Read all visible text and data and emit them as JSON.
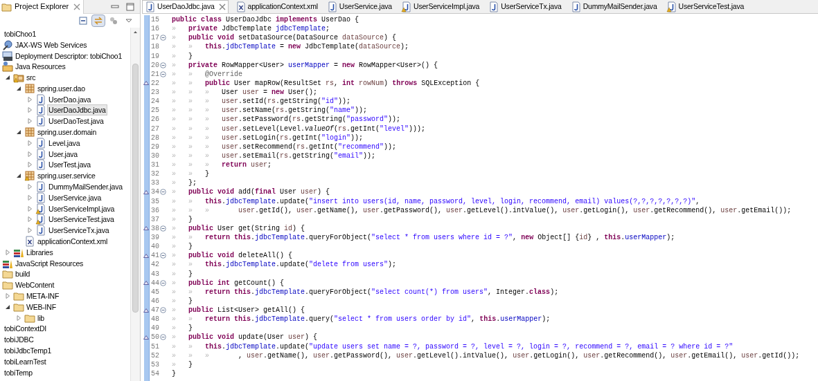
{
  "explorer": {
    "title": "Project Explorer",
    "toolbar": [
      {
        "kind": "collapse-all",
        "pressed": false
      },
      {
        "kind": "link-editor",
        "pressed": true
      },
      {
        "kind": "filters",
        "pressed": false
      },
      {
        "kind": "view-menu",
        "pressed": false
      }
    ],
    "tree": [
      {
        "label": "tobiChoo1",
        "selected": false,
        "children": [
          {
            "label": "JAX-WS Web Services",
            "kind": "webservices",
            "selected": false
          },
          {
            "label": "Deployment Descriptor: tobiChoo1",
            "kind": "descriptor",
            "selected": false
          },
          {
            "label": "Java Resources",
            "kind": "javares",
            "selected": false,
            "children": [
              {
                "label": "src",
                "kind": "src-warn",
                "expanded": true,
                "selected": false,
                "children": [
                  {
                    "label": "spring.user.dao",
                    "kind": "package",
                    "expanded": true,
                    "selected": false,
                    "children": [
                      {
                        "label": "UserDao.java",
                        "kind": "java",
                        "expanded": false,
                        "selected": false
                      },
                      {
                        "label": "UserDaoJdbc.java",
                        "kind": "java",
                        "expanded": false,
                        "selected": true
                      },
                      {
                        "label": "UserDaoTest.java",
                        "kind": "java",
                        "expanded": false,
                        "selected": false
                      }
                    ]
                  },
                  {
                    "label": "spring.user.domain",
                    "kind": "package",
                    "expanded": true,
                    "selected": false,
                    "children": [
                      {
                        "label": "Level.java",
                        "kind": "java",
                        "expanded": false,
                        "selected": false
                      },
                      {
                        "label": "User.java",
                        "kind": "java",
                        "expanded": false,
                        "selected": false
                      },
                      {
                        "label": "UserTest.java",
                        "kind": "java",
                        "expanded": false,
                        "selected": false
                      }
                    ]
                  },
                  {
                    "label": "spring.user.service",
                    "kind": "package-warn",
                    "expanded": true,
                    "selected": false,
                    "children": [
                      {
                        "label": "DummyMailSender.java",
                        "kind": "java",
                        "expanded": false,
                        "selected": false
                      },
                      {
                        "label": "UserService.java",
                        "kind": "java",
                        "expanded": false,
                        "selected": false
                      },
                      {
                        "label": "UserServiceImpl.java",
                        "kind": "java-warn",
                        "expanded": false,
                        "selected": false
                      },
                      {
                        "label": "UserServiceTest.java",
                        "kind": "java-warn",
                        "expanded": false,
                        "selected": false
                      },
                      {
                        "label": "UserServiceTx.java",
                        "kind": "java",
                        "expanded": false,
                        "selected": false
                      }
                    ]
                  },
                  {
                    "label": "applicationContext.xml",
                    "kind": "xml",
                    "selected": false
                  }
                ]
              },
              {
                "label": "Libraries",
                "kind": "library",
                "expanded": false,
                "selected": false
              }
            ]
          },
          {
            "label": "JavaScript Resources",
            "kind": "library",
            "selected": false
          },
          {
            "label": "build",
            "kind": "folder",
            "selected": false
          },
          {
            "label": "WebContent",
            "kind": "folder",
            "selected": false,
            "children": [
              {
                "label": "META-INF",
                "kind": "folder",
                "expanded": false,
                "selected": false
              },
              {
                "label": "WEB-INF",
                "kind": "folder",
                "expanded": true,
                "selected": false,
                "children": [
                  {
                    "label": "lib",
                    "kind": "folder",
                    "expanded": false,
                    "selected": false
                  }
                ]
              }
            ]
          }
        ]
      },
      {
        "label": "tobiContextDI",
        "selected": false
      },
      {
        "label": "tobiJDBC",
        "selected": false
      },
      {
        "label": "tobiJdbcTemp1",
        "selected": false
      },
      {
        "label": "tobiLearnTest",
        "selected": false
      },
      {
        "label": "tobiTemp",
        "selected": false
      }
    ]
  },
  "editor_tabs": [
    {
      "label": "UserDaoJdbc.java",
      "kind": "java",
      "selected": true
    },
    {
      "label": "applicationContext.xml",
      "kind": "xml",
      "selected": false
    },
    {
      "label": "UserService.java",
      "kind": "java",
      "selected": false
    },
    {
      "label": "UserServiceImpl.java",
      "kind": "java-warn",
      "selected": false
    },
    {
      "label": "UserServiceTx.java",
      "kind": "java",
      "selected": false
    },
    {
      "label": "DummyMailSender.java",
      "kind": "java",
      "selected": false
    },
    {
      "label": "UserServiceTest.java",
      "kind": "java-warn",
      "selected": false
    }
  ],
  "code": [
    {
      "number": "15",
      "fold": false,
      "override": false,
      "tokens": [
        {
          "kind": "kw",
          "text": "public class"
        },
        {
          "kind": "plain",
          "text": " UserDaoJdbc "
        },
        {
          "kind": "kw",
          "text": "implements"
        },
        {
          "kind": "plain",
          "text": " UserDao {"
        }
      ]
    },
    {
      "number": "16",
      "fold": false,
      "override": false,
      "tokens": [
        {
          "kind": "tab",
          "text": "»"
        },
        {
          "kind": "kw",
          "text": "private"
        },
        {
          "kind": "plain",
          "text": " JdbcTemplate "
        },
        {
          "kind": "field",
          "text": "jdbcTemplate"
        },
        {
          "kind": "plain",
          "text": ";"
        }
      ]
    },
    {
      "number": "17",
      "fold": true,
      "override": false,
      "tokens": [
        {
          "kind": "tab",
          "text": "»"
        },
        {
          "kind": "kw",
          "text": "public void"
        },
        {
          "kind": "plain",
          "text": " setDataSource(DataSource "
        },
        {
          "kind": "local",
          "text": "dataSource"
        },
        {
          "kind": "plain",
          "text": ") {"
        }
      ]
    },
    {
      "number": "18",
      "fold": false,
      "override": false,
      "tokens": [
        {
          "kind": "tab",
          "text": "»"
        },
        {
          "kind": "tab",
          "text": "»"
        },
        {
          "kind": "kw",
          "text": "this"
        },
        {
          "kind": "plain",
          "text": "."
        },
        {
          "kind": "field",
          "text": "jdbcTemplate"
        },
        {
          "kind": "plain",
          "text": " = "
        },
        {
          "kind": "kw",
          "text": "new"
        },
        {
          "kind": "plain",
          "text": " JdbcTemplate("
        },
        {
          "kind": "local",
          "text": "dataSource"
        },
        {
          "kind": "plain",
          "text": ");"
        }
      ]
    },
    {
      "number": "19",
      "fold": false,
      "override": false,
      "tokens": [
        {
          "kind": "tab",
          "text": "»"
        },
        {
          "kind": "plain",
          "text": "}"
        }
      ]
    },
    {
      "number": "20",
      "fold": true,
      "override": false,
      "tokens": [
        {
          "kind": "tab",
          "text": "»"
        },
        {
          "kind": "kw",
          "text": "private"
        },
        {
          "kind": "plain",
          "text": " RowMapper<User> "
        },
        {
          "kind": "field",
          "text": "userMapper"
        },
        {
          "kind": "plain",
          "text": " = "
        },
        {
          "kind": "kw",
          "text": "new"
        },
        {
          "kind": "plain",
          "text": " RowMapper<User>() {"
        }
      ]
    },
    {
      "number": "21",
      "fold": true,
      "override": false,
      "tokens": [
        {
          "kind": "tab",
          "text": "»"
        },
        {
          "kind": "tab",
          "text": "»"
        },
        {
          "kind": "ann",
          "text": "@Override"
        }
      ]
    },
    {
      "number": "22",
      "fold": false,
      "override": true,
      "tokens": [
        {
          "kind": "tab",
          "text": "»"
        },
        {
          "kind": "tab",
          "text": "»"
        },
        {
          "kind": "kw",
          "text": "public"
        },
        {
          "kind": "plain",
          "text": " User mapRow(ResultSet "
        },
        {
          "kind": "local",
          "text": "rs"
        },
        {
          "kind": "plain",
          "text": ", "
        },
        {
          "kind": "kw",
          "text": "int"
        },
        {
          "kind": "local",
          "text": " rowNum"
        },
        {
          "kind": "plain",
          "text": ") "
        },
        {
          "kind": "kw",
          "text": "throws"
        },
        {
          "kind": "plain",
          "text": " SQLException {"
        }
      ]
    },
    {
      "number": "23",
      "fold": false,
      "override": false,
      "tokens": [
        {
          "kind": "tab",
          "text": "»"
        },
        {
          "kind": "tab",
          "text": "»"
        },
        {
          "kind": "tab",
          "text": "»"
        },
        {
          "kind": "plain",
          "text": "User "
        },
        {
          "kind": "local",
          "text": "user"
        },
        {
          "kind": "plain",
          "text": " = "
        },
        {
          "kind": "kw",
          "text": "new"
        },
        {
          "kind": "plain",
          "text": " User();"
        }
      ]
    },
    {
      "number": "24",
      "fold": false,
      "override": false,
      "tokens": [
        {
          "kind": "tab",
          "text": "»"
        },
        {
          "kind": "tab",
          "text": "»"
        },
        {
          "kind": "tab",
          "text": "»"
        },
        {
          "kind": "local",
          "text": "user"
        },
        {
          "kind": "plain",
          "text": ".setId("
        },
        {
          "kind": "local",
          "text": "rs"
        },
        {
          "kind": "plain",
          "text": ".getString("
        },
        {
          "kind": "str",
          "text": "\"id\""
        },
        {
          "kind": "plain",
          "text": "));"
        }
      ]
    },
    {
      "number": "25",
      "fold": false,
      "override": false,
      "tokens": [
        {
          "kind": "tab",
          "text": "»"
        },
        {
          "kind": "tab",
          "text": "»"
        },
        {
          "kind": "tab",
          "text": "»"
        },
        {
          "kind": "local",
          "text": "user"
        },
        {
          "kind": "plain",
          "text": ".setName("
        },
        {
          "kind": "local",
          "text": "rs"
        },
        {
          "kind": "plain",
          "text": ".getString("
        },
        {
          "kind": "str",
          "text": "\"name\""
        },
        {
          "kind": "plain",
          "text": "));"
        }
      ]
    },
    {
      "number": "26",
      "fold": false,
      "override": false,
      "tokens": [
        {
          "kind": "tab",
          "text": "»"
        },
        {
          "kind": "tab",
          "text": "»"
        },
        {
          "kind": "tab",
          "text": "»"
        },
        {
          "kind": "local",
          "text": "user"
        },
        {
          "kind": "plain",
          "text": ".setPassword("
        },
        {
          "kind": "local",
          "text": "rs"
        },
        {
          "kind": "plain",
          "text": ".getString("
        },
        {
          "kind": "str",
          "text": "\"password\""
        },
        {
          "kind": "plain",
          "text": "));"
        }
      ]
    },
    {
      "number": "27",
      "fold": false,
      "override": false,
      "tokens": [
        {
          "kind": "tab",
          "text": "»"
        },
        {
          "kind": "tab",
          "text": "»"
        },
        {
          "kind": "tab",
          "text": "»"
        },
        {
          "kind": "local",
          "text": "user"
        },
        {
          "kind": "plain",
          "text": ".setLevel(Level."
        },
        {
          "kind": "static",
          "text": "valueOf"
        },
        {
          "kind": "plain",
          "text": "("
        },
        {
          "kind": "local",
          "text": "rs"
        },
        {
          "kind": "plain",
          "text": ".getInt("
        },
        {
          "kind": "str",
          "text": "\"level\""
        },
        {
          "kind": "plain",
          "text": ")));"
        }
      ]
    },
    {
      "number": "28",
      "fold": false,
      "override": false,
      "tokens": [
        {
          "kind": "tab",
          "text": "»"
        },
        {
          "kind": "tab",
          "text": "»"
        },
        {
          "kind": "tab",
          "text": "»"
        },
        {
          "kind": "local",
          "text": "user"
        },
        {
          "kind": "plain",
          "text": ".setLogin("
        },
        {
          "kind": "local",
          "text": "rs"
        },
        {
          "kind": "plain",
          "text": ".getInt("
        },
        {
          "kind": "str",
          "text": "\"login\""
        },
        {
          "kind": "plain",
          "text": "));"
        }
      ]
    },
    {
      "number": "29",
      "fold": false,
      "override": false,
      "tokens": [
        {
          "kind": "tab",
          "text": "»"
        },
        {
          "kind": "tab",
          "text": "»"
        },
        {
          "kind": "tab",
          "text": "»"
        },
        {
          "kind": "local",
          "text": "user"
        },
        {
          "kind": "plain",
          "text": ".setRecommend("
        },
        {
          "kind": "local",
          "text": "rs"
        },
        {
          "kind": "plain",
          "text": ".getInt("
        },
        {
          "kind": "str",
          "text": "\"recommend\""
        },
        {
          "kind": "plain",
          "text": "));"
        }
      ]
    },
    {
      "number": "30",
      "fold": false,
      "override": false,
      "tokens": [
        {
          "kind": "tab",
          "text": "»"
        },
        {
          "kind": "tab",
          "text": "»"
        },
        {
          "kind": "tab",
          "text": "»"
        },
        {
          "kind": "local",
          "text": "user"
        },
        {
          "kind": "plain",
          "text": ".setEmail("
        },
        {
          "kind": "local",
          "text": "rs"
        },
        {
          "kind": "plain",
          "text": ".getString("
        },
        {
          "kind": "str",
          "text": "\"email\""
        },
        {
          "kind": "plain",
          "text": "));"
        }
      ]
    },
    {
      "number": "31",
      "fold": false,
      "override": false,
      "tokens": [
        {
          "kind": "tab",
          "text": "»"
        },
        {
          "kind": "tab",
          "text": "»"
        },
        {
          "kind": "tab",
          "text": "»"
        },
        {
          "kind": "kw",
          "text": "return"
        },
        {
          "kind": "local",
          "text": " user"
        },
        {
          "kind": "plain",
          "text": ";"
        }
      ]
    },
    {
      "number": "32",
      "fold": false,
      "override": false,
      "tokens": [
        {
          "kind": "tab",
          "text": "»"
        },
        {
          "kind": "tab",
          "text": "»"
        },
        {
          "kind": "plain",
          "text": "}"
        }
      ]
    },
    {
      "number": "33",
      "fold": false,
      "override": false,
      "tokens": [
        {
          "kind": "tab",
          "text": "»"
        },
        {
          "kind": "plain",
          "text": "};"
        }
      ]
    },
    {
      "number": "34",
      "fold": true,
      "override": true,
      "tokens": [
        {
          "kind": "tab",
          "text": "»"
        },
        {
          "kind": "kw",
          "text": "public void"
        },
        {
          "kind": "plain",
          "text": " add("
        },
        {
          "kind": "kw",
          "text": "final"
        },
        {
          "kind": "plain",
          "text": " User "
        },
        {
          "kind": "local",
          "text": "user"
        },
        {
          "kind": "plain",
          "text": ") {"
        }
      ]
    },
    {
      "number": "35",
      "fold": false,
      "override": false,
      "tokens": [
        {
          "kind": "tab",
          "text": "»"
        },
        {
          "kind": "tab",
          "text": "»"
        },
        {
          "kind": "kw",
          "text": "this"
        },
        {
          "kind": "plain",
          "text": "."
        },
        {
          "kind": "field",
          "text": "jdbcTemplate"
        },
        {
          "kind": "plain",
          "text": ".update("
        },
        {
          "kind": "str",
          "text": "\"insert into users(id, name, password, level, login, recommend, email) values(?,?,?,?,?,?,?)\""
        },
        {
          "kind": "plain",
          "text": ","
        }
      ]
    },
    {
      "number": "36",
      "fold": false,
      "override": false,
      "tokens": [
        {
          "kind": "tab",
          "text": "»"
        },
        {
          "kind": "tab",
          "text": "»"
        },
        {
          "kind": "tab",
          "text": "»"
        },
        {
          "kind": "local",
          "text": "    user"
        },
        {
          "kind": "plain",
          "text": ".getId(), "
        },
        {
          "kind": "local",
          "text": "user"
        },
        {
          "kind": "plain",
          "text": ".getName(), "
        },
        {
          "kind": "local",
          "text": "user"
        },
        {
          "kind": "plain",
          "text": ".getPassword(), "
        },
        {
          "kind": "local",
          "text": "user"
        },
        {
          "kind": "plain",
          "text": ".getLevel().intValue(), "
        },
        {
          "kind": "local",
          "text": "user"
        },
        {
          "kind": "plain",
          "text": ".getLogin(), "
        },
        {
          "kind": "local",
          "text": "user"
        },
        {
          "kind": "plain",
          "text": ".getRecommend(), "
        },
        {
          "kind": "local",
          "text": "user"
        },
        {
          "kind": "plain",
          "text": ".getEmail());"
        }
      ]
    },
    {
      "number": "37",
      "fold": false,
      "override": false,
      "tokens": [
        {
          "kind": "tab",
          "text": "»"
        },
        {
          "kind": "plain",
          "text": "}"
        }
      ]
    },
    {
      "number": "38",
      "fold": true,
      "override": true,
      "tokens": [
        {
          "kind": "tab",
          "text": "»"
        },
        {
          "kind": "kw",
          "text": "public"
        },
        {
          "kind": "plain",
          "text": " User get(String "
        },
        {
          "kind": "local",
          "text": "id"
        },
        {
          "kind": "plain",
          "text": ") {"
        }
      ]
    },
    {
      "number": "39",
      "fold": false,
      "override": false,
      "tokens": [
        {
          "kind": "tab",
          "text": "»"
        },
        {
          "kind": "tab",
          "text": "»"
        },
        {
          "kind": "kw",
          "text": "return this"
        },
        {
          "kind": "plain",
          "text": "."
        },
        {
          "kind": "field",
          "text": "jdbcTemplate"
        },
        {
          "kind": "plain",
          "text": ".queryForObject("
        },
        {
          "kind": "str",
          "text": "\"select * from users where id = ?\""
        },
        {
          "kind": "plain",
          "text": ", "
        },
        {
          "kind": "kw",
          "text": "new"
        },
        {
          "kind": "plain",
          "text": " Object[] {"
        },
        {
          "kind": "local",
          "text": "id"
        },
        {
          "kind": "plain",
          "text": "} , "
        },
        {
          "kind": "kw",
          "text": "this"
        },
        {
          "kind": "plain",
          "text": "."
        },
        {
          "kind": "field",
          "text": "userMapper"
        },
        {
          "kind": "plain",
          "text": ");"
        }
      ]
    },
    {
      "number": "40",
      "fold": false,
      "override": false,
      "tokens": [
        {
          "kind": "tab",
          "text": "»"
        },
        {
          "kind": "plain",
          "text": "}"
        }
      ]
    },
    {
      "number": "41",
      "fold": true,
      "override": true,
      "tokens": [
        {
          "kind": "tab",
          "text": "»"
        },
        {
          "kind": "kw",
          "text": "public void"
        },
        {
          "kind": "plain",
          "text": " deleteAll() {"
        }
      ]
    },
    {
      "number": "42",
      "fold": false,
      "override": false,
      "tokens": [
        {
          "kind": "tab",
          "text": "»"
        },
        {
          "kind": "tab",
          "text": "»"
        },
        {
          "kind": "kw",
          "text": "this"
        },
        {
          "kind": "plain",
          "text": "."
        },
        {
          "kind": "field",
          "text": "jdbcTemplate"
        },
        {
          "kind": "plain",
          "text": ".update("
        },
        {
          "kind": "str",
          "text": "\"delete from users\""
        },
        {
          "kind": "plain",
          "text": ");"
        }
      ]
    },
    {
      "number": "43",
      "fold": false,
      "override": false,
      "tokens": [
        {
          "kind": "tab",
          "text": "»"
        },
        {
          "kind": "plain",
          "text": "}"
        }
      ]
    },
    {
      "number": "44",
      "fold": true,
      "override": true,
      "tokens": [
        {
          "kind": "tab",
          "text": "»"
        },
        {
          "kind": "kw",
          "text": "public int"
        },
        {
          "kind": "plain",
          "text": " getCount() {"
        }
      ]
    },
    {
      "number": "45",
      "fold": false,
      "override": false,
      "tokens": [
        {
          "kind": "tab",
          "text": "»"
        },
        {
          "kind": "tab",
          "text": "»"
        },
        {
          "kind": "kw",
          "text": "return this"
        },
        {
          "kind": "plain",
          "text": "."
        },
        {
          "kind": "field",
          "text": "jdbcTemplate"
        },
        {
          "kind": "plain",
          "text": ".queryForObject("
        },
        {
          "kind": "str",
          "text": "\"select count(*) from users\""
        },
        {
          "kind": "plain",
          "text": ", Integer."
        },
        {
          "kind": "kw",
          "text": "class"
        },
        {
          "kind": "plain",
          "text": ");"
        }
      ]
    },
    {
      "number": "46",
      "fold": false,
      "override": false,
      "tokens": [
        {
          "kind": "tab",
          "text": "»"
        },
        {
          "kind": "plain",
          "text": "}"
        }
      ]
    },
    {
      "number": "47",
      "fold": true,
      "override": true,
      "tokens": [
        {
          "kind": "tab",
          "text": "»"
        },
        {
          "kind": "kw",
          "text": "public"
        },
        {
          "kind": "plain",
          "text": " List<User> getAll() {"
        }
      ]
    },
    {
      "number": "48",
      "fold": false,
      "override": false,
      "tokens": [
        {
          "kind": "tab",
          "text": "»"
        },
        {
          "kind": "tab",
          "text": "»"
        },
        {
          "kind": "kw",
          "text": "return this"
        },
        {
          "kind": "plain",
          "text": "."
        },
        {
          "kind": "field",
          "text": "jdbcTemplate"
        },
        {
          "kind": "plain",
          "text": ".query("
        },
        {
          "kind": "str",
          "text": "\"select * from users order by id\""
        },
        {
          "kind": "plain",
          "text": ", "
        },
        {
          "kind": "kw",
          "text": "this"
        },
        {
          "kind": "plain",
          "text": "."
        },
        {
          "kind": "field",
          "text": "userMapper"
        },
        {
          "kind": "plain",
          "text": ");"
        }
      ]
    },
    {
      "number": "49",
      "fold": false,
      "override": false,
      "tokens": [
        {
          "kind": "tab",
          "text": "»"
        },
        {
          "kind": "plain",
          "text": "}"
        }
      ]
    },
    {
      "number": "50",
      "fold": true,
      "override": true,
      "tokens": [
        {
          "kind": "tab",
          "text": "»"
        },
        {
          "kind": "kw",
          "text": "public void"
        },
        {
          "kind": "plain",
          "text": " update(User "
        },
        {
          "kind": "local",
          "text": "user"
        },
        {
          "kind": "plain",
          "text": ") {"
        }
      ]
    },
    {
      "number": "51",
      "fold": false,
      "override": false,
      "tokens": [
        {
          "kind": "tab",
          "text": "»"
        },
        {
          "kind": "tab",
          "text": "»"
        },
        {
          "kind": "kw",
          "text": "this"
        },
        {
          "kind": "plain",
          "text": "."
        },
        {
          "kind": "field",
          "text": "jdbcTemplate"
        },
        {
          "kind": "plain",
          "text": ".update("
        },
        {
          "kind": "str",
          "text": "\"update users set name = ?, password = ?, level = ?, login = ?, recommend = ?, email = ? where id = ?\""
        }
      ]
    },
    {
      "number": "52",
      "fold": false,
      "override": false,
      "tokens": [
        {
          "kind": "tab",
          "text": "»"
        },
        {
          "kind": "tab",
          "text": "»"
        },
        {
          "kind": "tab",
          "text": "»"
        },
        {
          "kind": "plain",
          "text": "    , "
        },
        {
          "kind": "local",
          "text": "user"
        },
        {
          "kind": "plain",
          "text": ".getName(), "
        },
        {
          "kind": "local",
          "text": "user"
        },
        {
          "kind": "plain",
          "text": ".getPassword(), "
        },
        {
          "kind": "local",
          "text": "user"
        },
        {
          "kind": "plain",
          "text": ".getLevel().intValue(), "
        },
        {
          "kind": "local",
          "text": "user"
        },
        {
          "kind": "plain",
          "text": ".getLogin(), "
        },
        {
          "kind": "local",
          "text": "user"
        },
        {
          "kind": "plain",
          "text": ".getRecommend(), "
        },
        {
          "kind": "local",
          "text": "user"
        },
        {
          "kind": "plain",
          "text": ".getEmail(), "
        },
        {
          "kind": "local",
          "text": "user"
        },
        {
          "kind": "plain",
          "text": ".getId());"
        }
      ]
    },
    {
      "number": "53",
      "fold": false,
      "override": false,
      "tokens": [
        {
          "kind": "tab",
          "text": "»"
        },
        {
          "kind": "plain",
          "text": "}"
        }
      ]
    },
    {
      "number": "54",
      "fold": false,
      "override": false,
      "tokens": [
        {
          "kind": "plain",
          "text": "}"
        }
      ]
    }
  ]
}
